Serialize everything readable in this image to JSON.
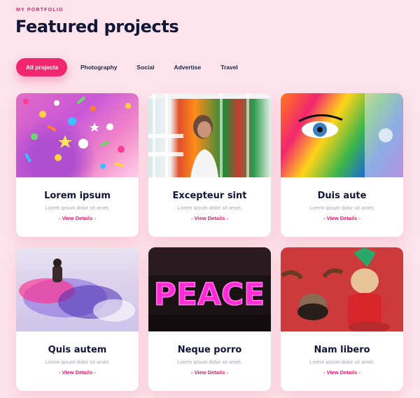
{
  "header": {
    "eyebrow": "MY PORTFOLIO",
    "title": "Featured projects"
  },
  "filters": [
    {
      "label": "All projects",
      "active": true
    },
    {
      "label": "Photography",
      "active": false
    },
    {
      "label": "Social",
      "active": false
    },
    {
      "label": "Advertise",
      "active": false
    },
    {
      "label": "Travel",
      "active": false
    }
  ],
  "projects": [
    {
      "title": "Lorem ipsum",
      "subtitle": "Lorem ipsum dolor sit amet.",
      "link": "- View Details -"
    },
    {
      "title": "Excepteur sint",
      "subtitle": "Lorem ipsum dolor sit amet.",
      "link": "- View Details -"
    },
    {
      "title": "Duis aute",
      "subtitle": "Lorem ipsum dolor sit amet.",
      "link": "- View Details -"
    },
    {
      "title": "Quis autem",
      "subtitle": "Lorem ipsum dolor sit amet.",
      "link": "- View Details -"
    },
    {
      "title": "Neque porro",
      "subtitle": "Lorem ipsum dolor sit amet.",
      "link": "- View Details -"
    },
    {
      "title": "Nam libero",
      "subtitle": "Lorem ipsum dolor sit amet.",
      "link": "- View Details -"
    }
  ],
  "peace_sign": "PEACE",
  "colors": {
    "accent": "#f2266f",
    "background": "#fde4ec",
    "title": "#101436"
  }
}
